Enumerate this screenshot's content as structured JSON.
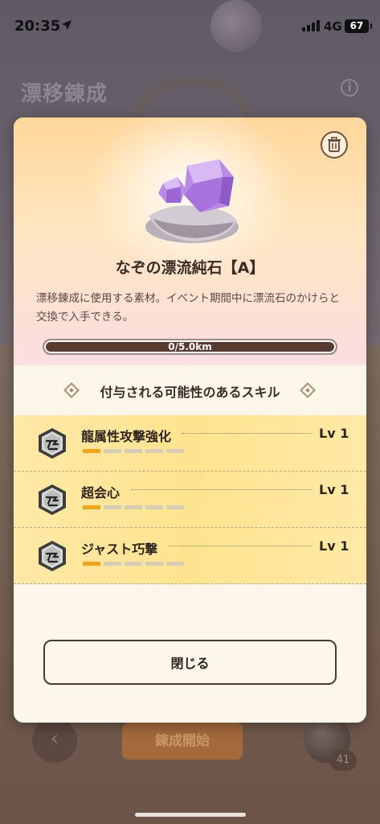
{
  "status_bar": {
    "time": "20:35",
    "location_icon": "location-arrow-icon",
    "network": "4G",
    "battery": "67"
  },
  "background": {
    "title": "漂移錬成",
    "info_icon": "info-icon",
    "start_button": "錬成開始",
    "back_icon": "chevron-left-icon",
    "count": "41"
  },
  "modal": {
    "trash_icon": "trash-icon",
    "item_name": "なぞの漂流純石【A】",
    "description": "漂移錬成に使用する素材。イベント期間中に漂流石のかけらと交換で入手できる。",
    "progress": {
      "text": "0/5.0km",
      "current": 0,
      "max": 5.0
    },
    "skills_title": "付与される可能性のあるスキル",
    "skills": [
      {
        "name": "龍属性攻撃強化",
        "level": "Lv 1",
        "filled": 1,
        "total": 5
      },
      {
        "name": "超会心",
        "level": "Lv 1",
        "filled": 1,
        "total": 5
      },
      {
        "name": "ジャスト巧撃",
        "level": "Lv 1",
        "filled": 1,
        "total": 5
      }
    ],
    "close_label": "閉じる"
  },
  "colors": {
    "skill_row": "#ffe38f",
    "level_bar_on": "#f1a619",
    "level_bar_off": "#d6ccba",
    "progress_track": "#5a3b32",
    "crystal": "#b07fe0"
  }
}
